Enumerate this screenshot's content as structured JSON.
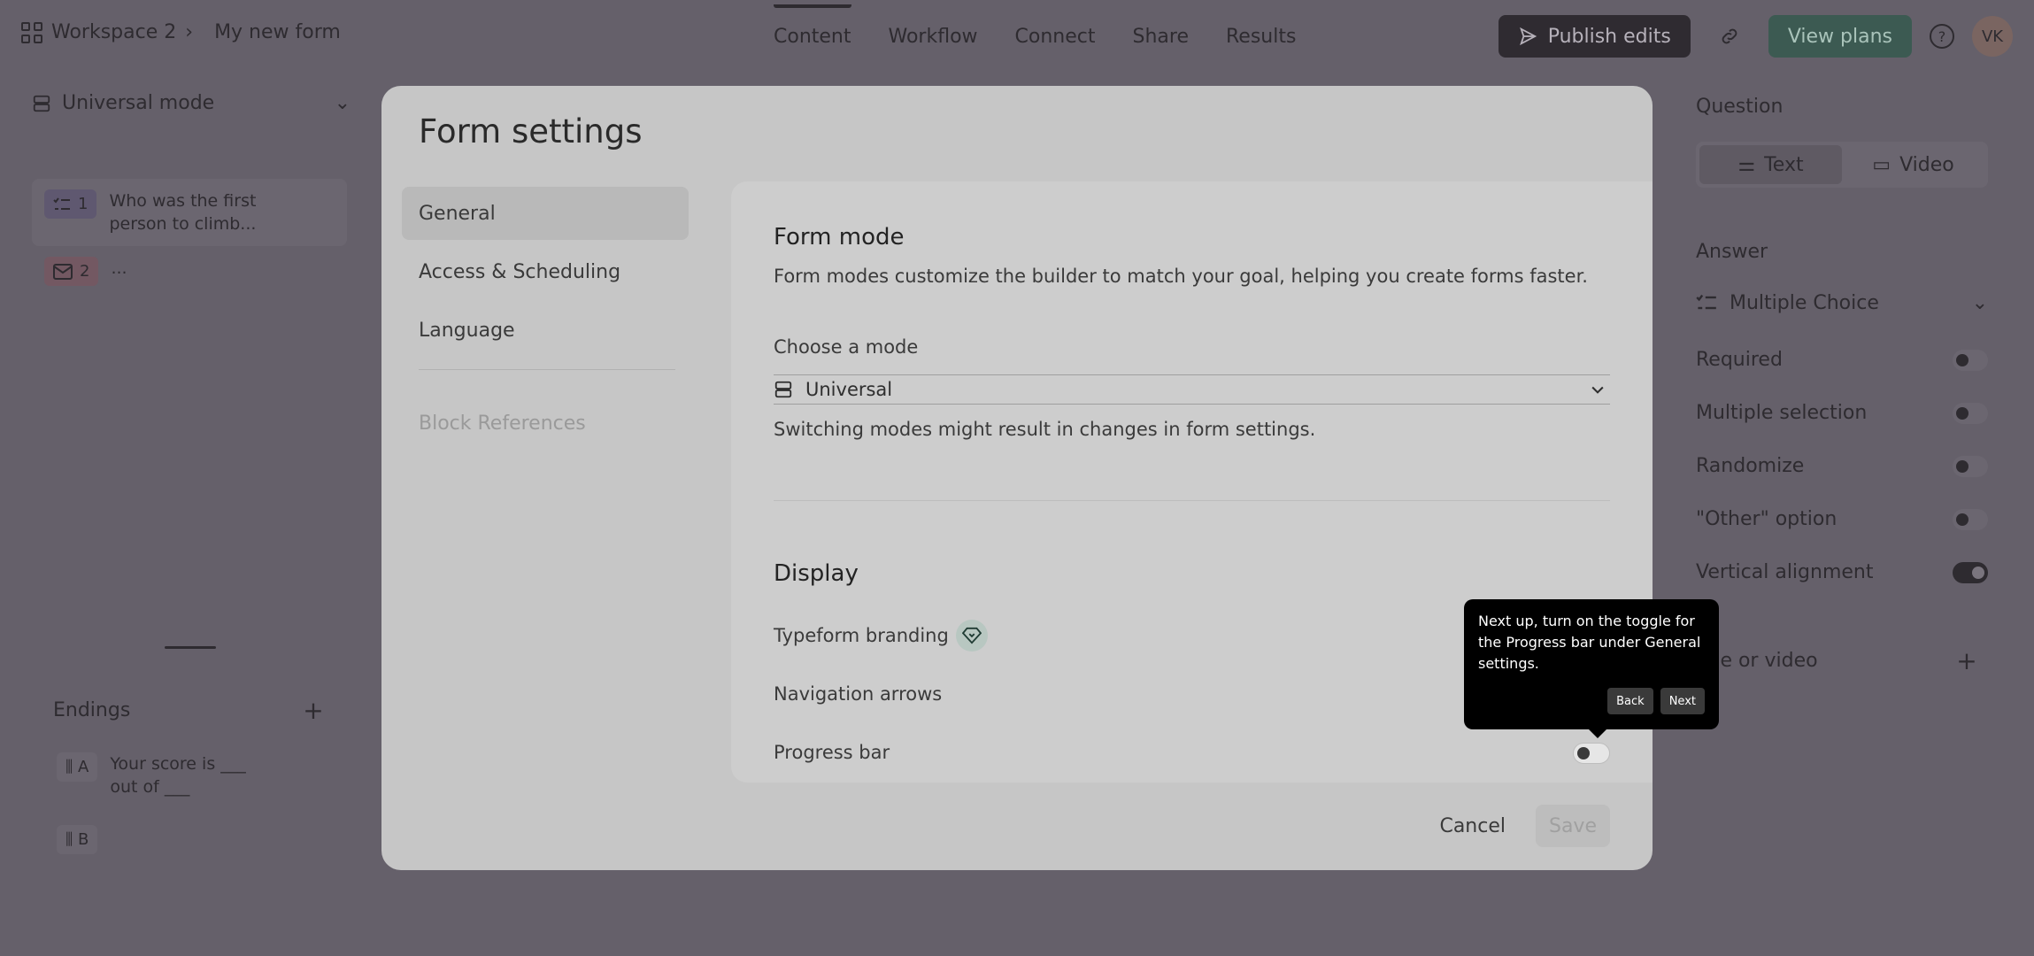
{
  "topbar": {
    "workspace": "Workspace 2",
    "separator": "›",
    "form_name": "My new form",
    "tabs": [
      "Content",
      "Workflow",
      "Connect",
      "Share",
      "Results"
    ],
    "publish_label": "Publish edits",
    "view_plans_label": "View plans",
    "help_glyph": "?",
    "avatar_initials": "VK"
  },
  "left_panel": {
    "mode_label": "Universal mode",
    "questions": [
      {
        "number": "1",
        "text": "Who was the first person to climb..."
      },
      {
        "number": "2",
        "text": "..."
      }
    ],
    "endings_title": "Endings",
    "endings": [
      {
        "letter": "A",
        "text": "Your score is ___ out of ___"
      },
      {
        "letter": "B",
        "text": ""
      }
    ]
  },
  "right_panel": {
    "question_label": "Question",
    "seg_text": "Text",
    "seg_video": "Video",
    "answer_label": "Answer",
    "answer_type": "Multiple Choice",
    "options": [
      {
        "label": "Required",
        "on": false
      },
      {
        "label": "Multiple selection",
        "on": false
      },
      {
        "label": "Randomize",
        "on": false
      },
      {
        "label": "\"Other\" option",
        "on": false
      },
      {
        "label": "Vertical alignment",
        "on": true
      }
    ],
    "image_video_label": "age or video"
  },
  "modal": {
    "title": "Form settings",
    "nav": {
      "general": "General",
      "access": "Access & Scheduling",
      "language": "Language",
      "block_refs": "Block References"
    },
    "form_mode": {
      "title": "Form mode",
      "description": "Form modes customize the builder to match your goal, helping you create forms faster.",
      "choose_label": "Choose a mode",
      "selected": "Universal",
      "hint": "Switching modes might result in changes in form settings."
    },
    "display": {
      "title": "Display",
      "typeform_branding": "Typeform branding",
      "navigation_arrows": "Navigation arrows",
      "progress_bar": "Progress bar",
      "progress_bar_on": false
    },
    "cancel_label": "Cancel",
    "save_label": "Save"
  },
  "tooltip": {
    "text": "Next up, turn on the toggle for the Progress bar under General settings.",
    "back_label": "Back",
    "next_label": "Next"
  }
}
